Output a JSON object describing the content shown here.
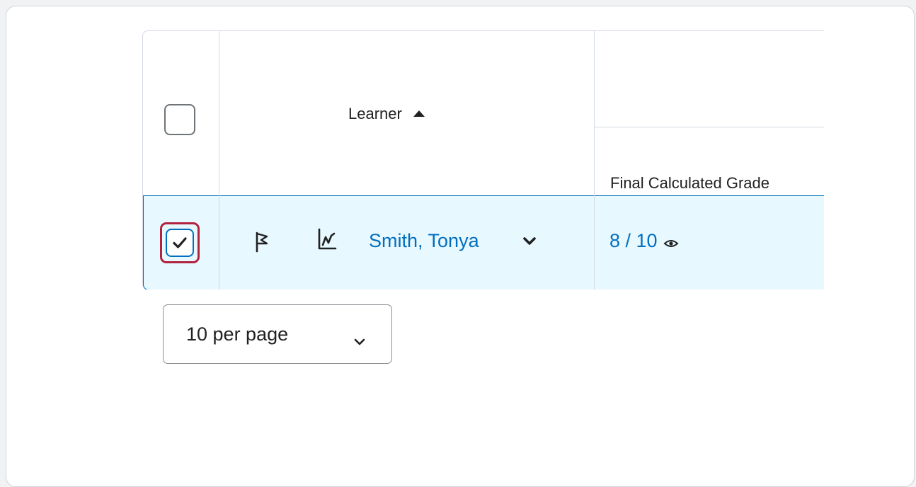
{
  "grid": {
    "learner_header": "Learner",
    "final_grade_header": "Final Calculated Grade"
  },
  "row": {
    "learner_name": "Smith, Tonya",
    "grade": "8 / 10",
    "selected": true
  },
  "pagination": {
    "per_page_label": "10 per page"
  },
  "icons": {
    "sort": "sort-ascending-icon",
    "flag": "flag-icon",
    "stats": "stats-icon",
    "chevron": "chevron-down-icon",
    "visibility": "eye-icon",
    "check": "checkmark-icon"
  },
  "colors": {
    "link": "#006fbf",
    "selected_row_bg": "#e8f8ff",
    "focus_ring": "#b0243f"
  }
}
